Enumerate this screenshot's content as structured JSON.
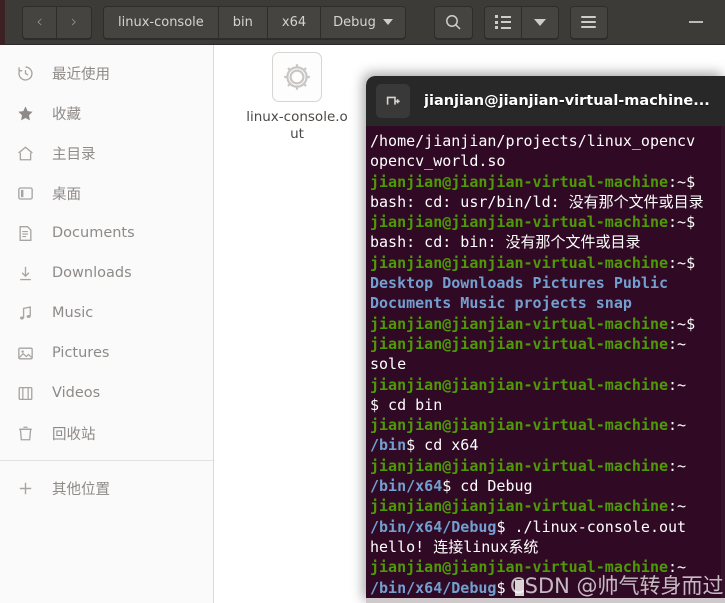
{
  "window": {
    "title_bar_buttons": {
      "back": "‹",
      "forward": "›",
      "minimize": "–"
    }
  },
  "toolbar": {
    "breadcrumbs": [
      {
        "label": "linux-console",
        "selected": false
      },
      {
        "label": "bin",
        "selected": false
      },
      {
        "label": "x64",
        "selected": false
      },
      {
        "label": "Debug",
        "selected": true
      }
    ],
    "search_icon": "search-icon",
    "view_list_icon": "list-view-icon",
    "view_dropdown_icon": "chevron-down-icon",
    "menu_icon": "hamburger-menu-icon"
  },
  "sidebar": {
    "items": [
      {
        "label": "最近使用",
        "icon": "recent-clock-icon"
      },
      {
        "label": "收藏",
        "icon": "star-icon"
      },
      {
        "label": "主目录",
        "icon": "home-icon"
      },
      {
        "label": "桌面",
        "icon": "desktop-icon"
      },
      {
        "label": "Documents",
        "icon": "document-icon"
      },
      {
        "label": "Downloads",
        "icon": "download-icon"
      },
      {
        "label": "Music",
        "icon": "music-note-icon"
      },
      {
        "label": "Pictures",
        "icon": "picture-icon"
      },
      {
        "label": "Videos",
        "icon": "video-film-icon"
      },
      {
        "label": "回收站",
        "icon": "trash-icon"
      }
    ],
    "other_locations": {
      "label": "其他位置",
      "icon": "plus-icon"
    }
  },
  "files": [
    {
      "name": "linux-console.out",
      "icon": "gear-executable-icon"
    }
  ],
  "terminal": {
    "title": "jianjian@jianjian-virtual-machine...",
    "title_icon": "new-tab-icon",
    "lines": [
      {
        "segs": [
          {
            "t": "/home/jianjian/projects/linux_opencv",
            "c": "c-white"
          }
        ]
      },
      {
        "segs": [
          {
            "t": "opencv_world.so",
            "c": "c-white"
          }
        ]
      },
      {
        "segs": [
          {
            "t": "jianjian@jianjian-virtual-machine",
            "c": "c-green"
          },
          {
            "t": ":~$",
            "c": "c-white"
          }
        ]
      },
      {
        "segs": [
          {
            "t": "bash: cd: usr/bin/ld: 没有那个文件或目录",
            "c": "c-white"
          }
        ]
      },
      {
        "segs": [
          {
            "t": "jianjian@jianjian-virtual-machine",
            "c": "c-green"
          },
          {
            "t": ":~$",
            "c": "c-white"
          }
        ]
      },
      {
        "segs": [
          {
            "t": "bash: cd: bin: 没有那个文件或目录",
            "c": "c-white"
          }
        ]
      },
      {
        "segs": [
          {
            "t": "jianjian@jianjian-virtual-machine",
            "c": "c-green"
          },
          {
            "t": ":~$",
            "c": "c-white"
          }
        ]
      },
      {
        "segs": [
          {
            "t": "Desktop    Downloads  Pictures  Public",
            "c": "c-blue"
          }
        ]
      },
      {
        "segs": [
          {
            "t": "Documents  Music      projects  snap",
            "c": "c-blue"
          }
        ]
      },
      {
        "segs": [
          {
            "t": "jianjian@jianjian-virtual-machine",
            "c": "c-green"
          },
          {
            "t": ":~$",
            "c": "c-white"
          }
        ]
      },
      {
        "segs": [
          {
            "t": "jianjian@jianjian-virtual-machine",
            "c": "c-green"
          },
          {
            "t": ":~",
            "c": "c-white"
          }
        ]
      },
      {
        "segs": [
          {
            "t": "sole",
            "c": "c-white"
          }
        ]
      },
      {
        "segs": [
          {
            "t": "jianjian@jianjian-virtual-machine",
            "c": "c-green"
          },
          {
            "t": ":~",
            "c": "c-white"
          }
        ]
      },
      {
        "segs": [
          {
            "t": "$ cd bin",
            "c": "c-white"
          }
        ]
      },
      {
        "segs": [
          {
            "t": "jianjian@jianjian-virtual-machine",
            "c": "c-green"
          },
          {
            "t": ":~",
            "c": "c-white"
          }
        ]
      },
      {
        "segs": [
          {
            "t": "/bin",
            "c": "c-blue"
          },
          {
            "t": "$ cd x64",
            "c": "c-white"
          }
        ]
      },
      {
        "segs": [
          {
            "t": "jianjian@jianjian-virtual-machine",
            "c": "c-green"
          },
          {
            "t": ":~",
            "c": "c-white"
          }
        ]
      },
      {
        "segs": [
          {
            "t": "/bin/x64",
            "c": "c-blue"
          },
          {
            "t": "$ cd Debug",
            "c": "c-white"
          }
        ]
      },
      {
        "segs": [
          {
            "t": "jianjian@jianjian-virtual-machine",
            "c": "c-green"
          },
          {
            "t": ":~",
            "c": "c-white"
          }
        ]
      },
      {
        "segs": [
          {
            "t": "/bin/x64/Debug",
            "c": "c-blue"
          },
          {
            "t": "$ ./linux-console.out",
            "c": "c-white"
          }
        ]
      },
      {
        "segs": [
          {
            "t": "hello! 连接linux系统",
            "c": "c-white"
          }
        ]
      },
      {
        "segs": [
          {
            "t": "jianjian@jianjian-virtual-machine",
            "c": "c-green"
          },
          {
            "t": ":~",
            "c": "c-white"
          }
        ]
      },
      {
        "segs": [
          {
            "t": "/bin/x64/Debug",
            "c": "c-blue"
          },
          {
            "t": "$ ",
            "c": "c-white"
          },
          {
            "cursor": true
          }
        ]
      }
    ]
  },
  "watermark": {
    "text": "CSDN @帅气转身而过"
  },
  "colors": {
    "header_bg": "#3c3b37",
    "sidebar_bg": "#fbfafa",
    "terminal_bg": "#300a24",
    "prompt_green": "#4e9a06",
    "dir_blue": "#729fcf",
    "text_white": "#ffffff"
  }
}
